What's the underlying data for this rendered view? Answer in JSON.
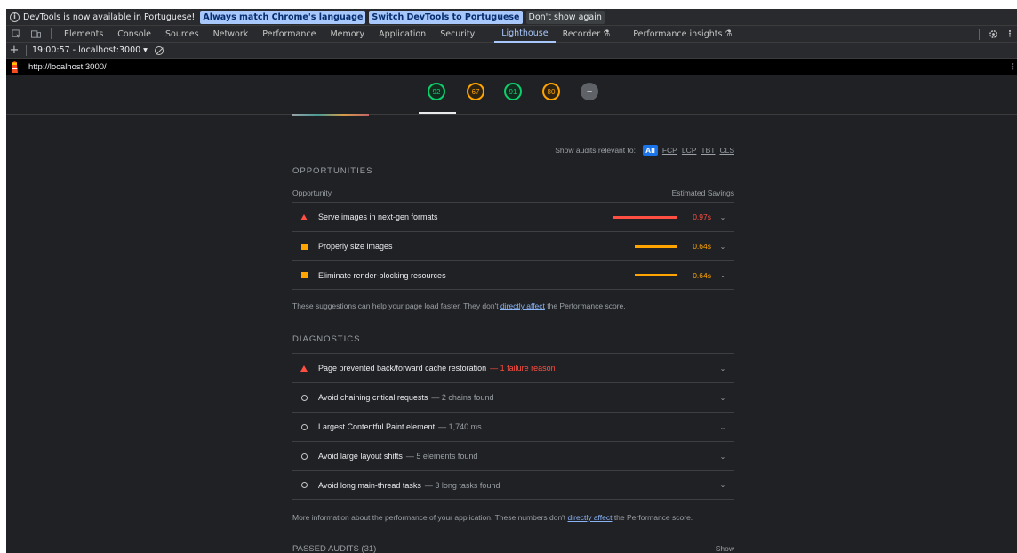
{
  "infobar": {
    "message": "DevTools is now available in Portuguese!",
    "btn_match": "Always match Chrome's language",
    "btn_switch": "Switch DevTools to Portuguese",
    "btn_dismiss": "Don't show again"
  },
  "tabs": [
    {
      "label": "Elements"
    },
    {
      "label": "Console"
    },
    {
      "label": "Sources"
    },
    {
      "label": "Network"
    },
    {
      "label": "Performance"
    },
    {
      "label": "Memory"
    },
    {
      "label": "Application"
    },
    {
      "label": "Security"
    },
    {
      "label": "Lighthouse",
      "active": true
    },
    {
      "label": "Recorder"
    },
    {
      "label": "Performance insights"
    }
  ],
  "toolbar": {
    "plus": "+",
    "report_select": "19:00:57 - localhost:3000 ▾"
  },
  "url": "http://localhost:3000/",
  "gauges": [
    {
      "value": "92",
      "status": "green"
    },
    {
      "value": "67",
      "status": "orange"
    },
    {
      "value": "91",
      "status": "green"
    },
    {
      "value": "80",
      "status": "orange"
    },
    {
      "value": "–",
      "status": "pwa"
    }
  ],
  "filters": {
    "label": "Show audits relevant to:",
    "chips": [
      "All",
      "FCP",
      "LCP",
      "TBT",
      "CLS"
    ],
    "active": "All"
  },
  "opportunities": {
    "title": "OPPORTUNITIES",
    "col_left": "Opportunity",
    "col_right": "Estimated Savings",
    "items": [
      {
        "title": "Serve images in next-gen formats",
        "savings": "0.97s",
        "fraction": 1.0,
        "severity": "fail"
      },
      {
        "title": "Properly size images",
        "savings": "0.64s",
        "fraction": 0.66,
        "severity": "average"
      },
      {
        "title": "Eliminate render-blocking resources",
        "savings": "0.64s",
        "fraction": 0.66,
        "severity": "average"
      }
    ],
    "note_before": "These suggestions can help your page load faster. They don't ",
    "note_link": "directly affect",
    "note_after": " the Performance score."
  },
  "diagnostics": {
    "title": "DIAGNOSTICS",
    "items": [
      {
        "title": "Page prevented back/forward cache restoration",
        "detail": "— 1 failure reason",
        "severity": "fail"
      },
      {
        "title": "Avoid chaining critical requests",
        "detail": "— 2 chains found",
        "severity": "info"
      },
      {
        "title": "Largest Contentful Paint element",
        "detail": "— 1,740 ms",
        "severity": "info"
      },
      {
        "title": "Avoid large layout shifts",
        "detail": "— 5 elements found",
        "severity": "info"
      },
      {
        "title": "Avoid long main-thread tasks",
        "detail": "— 3 long tasks found",
        "severity": "info"
      }
    ],
    "note_before": "More information about the performance of your application. These numbers don't ",
    "note_link": "directly affect",
    "note_after": " the Performance score."
  },
  "passed": {
    "title": "PASSED AUDITS (31)",
    "show": "Show"
  },
  "colors": {
    "pass": "#0cce6b",
    "average": "#ffa400",
    "fail": "#ff4e42",
    "accent": "#a8c7fa"
  }
}
